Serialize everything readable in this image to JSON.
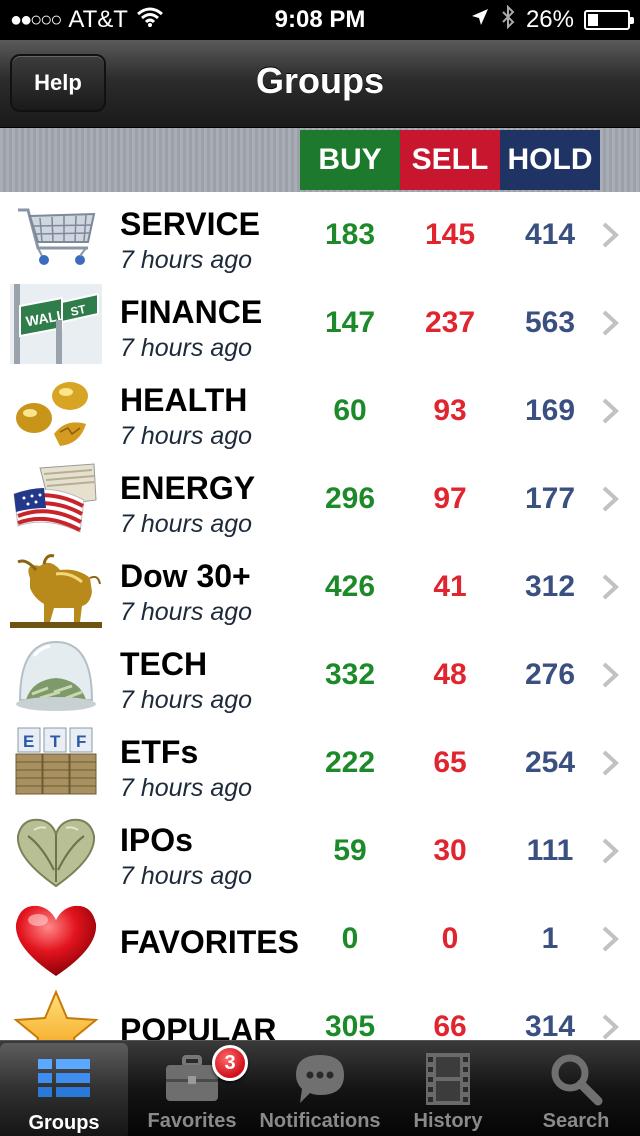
{
  "status_bar": {
    "signal": "●●○○○",
    "carrier": "AT&T",
    "time": "9:08 PM",
    "battery": "26%",
    "battery_level": 0.26
  },
  "nav": {
    "title": "Groups",
    "help_label": "Help"
  },
  "columns": {
    "buy": "BUY",
    "sell": "SELL",
    "hold": "HOLD"
  },
  "colors": {
    "buy": "#1d8a2a",
    "sell": "#e0252f",
    "hold": "#3a5080",
    "buy_header": "#1d7a2c",
    "sell_header": "#c8162e",
    "hold_header": "#1f3465"
  },
  "groups": [
    {
      "name": "SERVICE",
      "updated": "7 hours ago",
      "buy": "183",
      "sell": "145",
      "hold": "414",
      "icon": "shopping-cart-icon"
    },
    {
      "name": "FINANCE",
      "updated": "7 hours ago",
      "buy": "147",
      "sell": "237",
      "hold": "563",
      "icon": "wall-street-sign-icon"
    },
    {
      "name": "HEALTH",
      "updated": "7 hours ago",
      "buy": "60",
      "sell": "93",
      "hold": "169",
      "icon": "golden-eggs-icon"
    },
    {
      "name": "ENERGY",
      "updated": "7 hours ago",
      "buy": "296",
      "sell": "97",
      "hold": "177",
      "icon": "flag-money-icon"
    },
    {
      "name": "Dow 30+",
      "updated": "7 hours ago",
      "buy": "426",
      "sell": "41",
      "hold": "312",
      "icon": "golden-bull-icon"
    },
    {
      "name": "TECH",
      "updated": "7 hours ago",
      "buy": "332",
      "sell": "48",
      "hold": "276",
      "icon": "money-dome-icon"
    },
    {
      "name": "ETFs",
      "updated": "7 hours ago",
      "buy": "222",
      "sell": "65",
      "hold": "254",
      "icon": "etf-coins-icon"
    },
    {
      "name": "IPOs",
      "updated": "7 hours ago",
      "buy": "59",
      "sell": "30",
      "hold": "111",
      "icon": "money-heart-icon"
    },
    {
      "name": "FAVORITES",
      "updated": "",
      "buy": "0",
      "sell": "0",
      "hold": "1",
      "icon": "heart-icon"
    },
    {
      "name": "POPULAR",
      "updated": "",
      "buy": "305",
      "sell": "66",
      "hold": "314",
      "icon": "star-icon"
    }
  ],
  "tabs": [
    {
      "label": "Groups",
      "icon": "groups-list-icon",
      "active": true
    },
    {
      "label": "Favorites",
      "icon": "briefcase-icon",
      "badge": "3"
    },
    {
      "label": "Notifications",
      "icon": "speech-bubble-icon"
    },
    {
      "label": "History",
      "icon": "film-strip-icon"
    },
    {
      "label": "Search",
      "icon": "magnifier-icon"
    }
  ]
}
